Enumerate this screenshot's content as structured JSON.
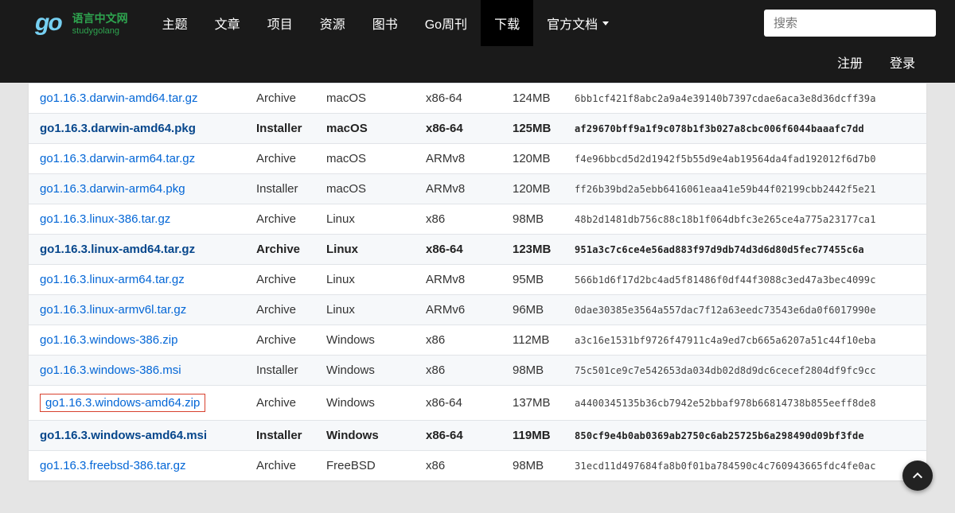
{
  "logo": {
    "cn": "语言中文网",
    "en": "studygolang"
  },
  "nav": {
    "items": [
      {
        "label": "主题",
        "active": false,
        "dropdown": false
      },
      {
        "label": "文章",
        "active": false,
        "dropdown": false
      },
      {
        "label": "项目",
        "active": false,
        "dropdown": false
      },
      {
        "label": "资源",
        "active": false,
        "dropdown": false
      },
      {
        "label": "图书",
        "active": false,
        "dropdown": false
      },
      {
        "label": "Go周刊",
        "active": false,
        "dropdown": false
      },
      {
        "label": "下载",
        "active": true,
        "dropdown": false
      },
      {
        "label": "官方文档",
        "active": false,
        "dropdown": true
      }
    ],
    "search_placeholder": "搜索",
    "sublinks": [
      "注册",
      "登录"
    ]
  },
  "rows": [
    {
      "file": "go1.16.3.darwin-amd64.tar.gz",
      "kind": "Archive",
      "os": "macOS",
      "arch": "x86-64",
      "size": "124MB",
      "sha": "6bb1cf421f8abc2a9a4e39140b7397cdae6aca3e8d36dcff39a",
      "hl": false,
      "striped": false,
      "boxed": false
    },
    {
      "file": "go1.16.3.darwin-amd64.pkg",
      "kind": "Installer",
      "os": "macOS",
      "arch": "x86-64",
      "size": "125MB",
      "sha": "af29670bff9a1f9c078b1f3b027a8cbc006f6044baaafc7dd",
      "hl": true,
      "striped": true,
      "boxed": false
    },
    {
      "file": "go1.16.3.darwin-arm64.tar.gz",
      "kind": "Archive",
      "os": "macOS",
      "arch": "ARMv8",
      "size": "120MB",
      "sha": "f4e96bbcd5d2d1942f5b55d9e4ab19564da4fad192012f6d7b0",
      "hl": false,
      "striped": false,
      "boxed": false
    },
    {
      "file": "go1.16.3.darwin-arm64.pkg",
      "kind": "Installer",
      "os": "macOS",
      "arch": "ARMv8",
      "size": "120MB",
      "sha": "ff26b39bd2a5ebb6416061eaa41e59b44f02199cbb2442f5e21",
      "hl": false,
      "striped": true,
      "boxed": false
    },
    {
      "file": "go1.16.3.linux-386.tar.gz",
      "kind": "Archive",
      "os": "Linux",
      "arch": "x86",
      "size": "98MB",
      "sha": "48b2d1481db756c88c18b1f064dbfc3e265ce4a775a23177ca1",
      "hl": false,
      "striped": false,
      "boxed": false
    },
    {
      "file": "go1.16.3.linux-amd64.tar.gz",
      "kind": "Archive",
      "os": "Linux",
      "arch": "x86-64",
      "size": "123MB",
      "sha": "951a3c7c6ce4e56ad883f97d9db74d3d6d80d5fec77455c6a",
      "hl": true,
      "striped": true,
      "boxed": false
    },
    {
      "file": "go1.16.3.linux-arm64.tar.gz",
      "kind": "Archive",
      "os": "Linux",
      "arch": "ARMv8",
      "size": "95MB",
      "sha": "566b1d6f17d2bc4ad5f81486f0df44f3088c3ed47a3bec4099c",
      "hl": false,
      "striped": false,
      "boxed": false
    },
    {
      "file": "go1.16.3.linux-armv6l.tar.gz",
      "kind": "Archive",
      "os": "Linux",
      "arch": "ARMv6",
      "size": "96MB",
      "sha": "0dae30385e3564a557dac7f12a63eedc73543e6da0f6017990e",
      "hl": false,
      "striped": true,
      "boxed": false
    },
    {
      "file": "go1.16.3.windows-386.zip",
      "kind": "Archive",
      "os": "Windows",
      "arch": "x86",
      "size": "112MB",
      "sha": "a3c16e1531bf9726f47911c4a9ed7cb665a6207a51c44f10eba",
      "hl": false,
      "striped": false,
      "boxed": false
    },
    {
      "file": "go1.16.3.windows-386.msi",
      "kind": "Installer",
      "os": "Windows",
      "arch": "x86",
      "size": "98MB",
      "sha": "75c501ce9c7e542653da034db02d8d9dc6cecef2804df9fc9cc",
      "hl": false,
      "striped": true,
      "boxed": false
    },
    {
      "file": "go1.16.3.windows-amd64.zip",
      "kind": "Archive",
      "os": "Windows",
      "arch": "x86-64",
      "size": "137MB",
      "sha": "a4400345135b36cb7942e52bbaf978b66814738b855eeff8de8",
      "hl": false,
      "striped": false,
      "boxed": true
    },
    {
      "file": "go1.16.3.windows-amd64.msi",
      "kind": "Installer",
      "os": "Windows",
      "arch": "x86-64",
      "size": "119MB",
      "sha": "850cf9e4b0ab0369ab2750c6ab25725b6a298490d09bf3fde",
      "hl": true,
      "striped": true,
      "boxed": false
    },
    {
      "file": "go1.16.3.freebsd-386.tar.gz",
      "kind": "Archive",
      "os": "FreeBSD",
      "arch": "x86",
      "size": "98MB",
      "sha": "31ecd11d497684fa8b0f01ba784590c4c760943665fdc4fe0ac",
      "hl": false,
      "striped": false,
      "boxed": false
    }
  ]
}
